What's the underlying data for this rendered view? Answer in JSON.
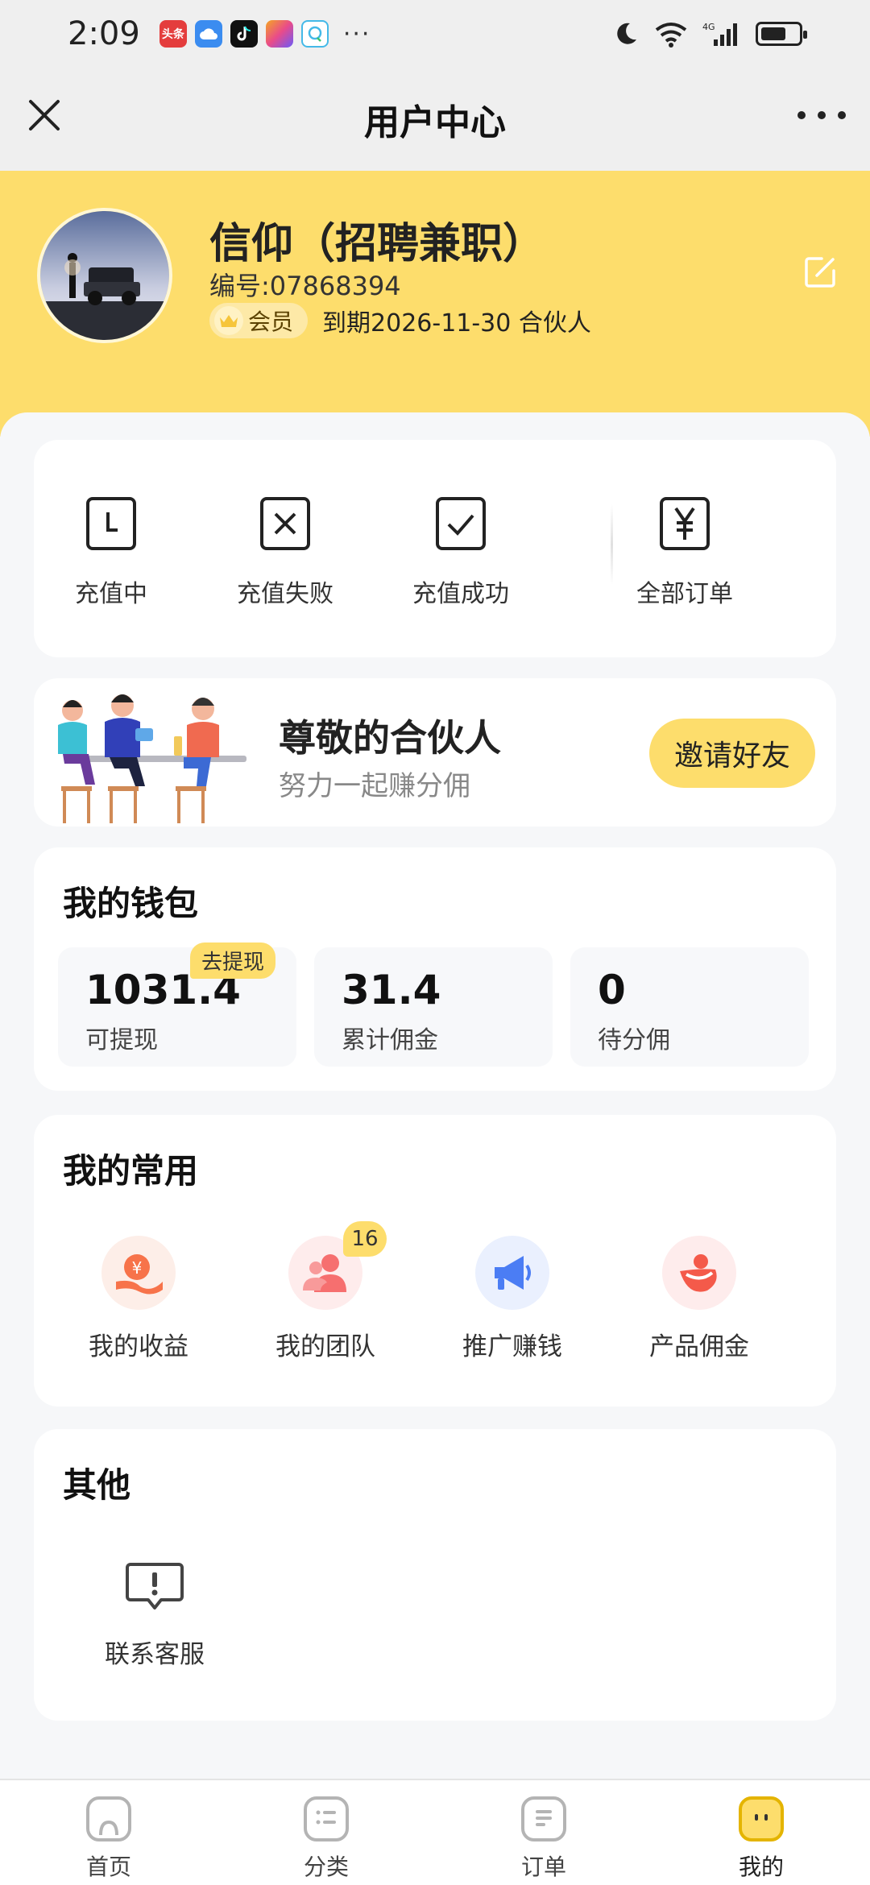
{
  "status_bar": {
    "time": "2:09",
    "app_icons": [
      {
        "name": "toutiao-icon",
        "text": "头条",
        "color": "#e43d3d"
      },
      {
        "name": "cloud-icon",
        "text": "",
        "color": "#3b8cf0"
      },
      {
        "name": "tiktok-icon",
        "text": "",
        "color": "#111111"
      },
      {
        "name": "app-icon",
        "text": "",
        "color": "#f5a623"
      },
      {
        "name": "chat-icon",
        "text": "",
        "color": "#44b9e8"
      }
    ],
    "more": "···",
    "network": "4G"
  },
  "header": {
    "title": "用户中心"
  },
  "profile": {
    "name": "信仰（招聘兼职）",
    "id_text": "编号:07868394",
    "member_label": "会员",
    "expiry_text": "到期2026-11-30 合伙人"
  },
  "orders": [
    {
      "label": "充值中",
      "icon": "clock-icon"
    },
    {
      "label": "充值失败",
      "icon": "failed-icon"
    },
    {
      "label": "充值成功",
      "icon": "success-icon"
    },
    {
      "label": "全部订单",
      "icon": "yuan-icon"
    }
  ],
  "banner": {
    "title": "尊敬的合伙人",
    "subtitle": "努力一起赚分佣",
    "button": "邀请好友"
  },
  "wallet": {
    "title": "我的钱包",
    "withdraw_tag": "去提现",
    "items": [
      {
        "value": "1031.4",
        "label": "可提现"
      },
      {
        "value": "31.4",
        "label": "累计佣金"
      },
      {
        "value": "0",
        "label": "待分佣"
      }
    ]
  },
  "common": {
    "title": "我的常用",
    "items": [
      {
        "label": "我的收益",
        "icon": "earnings-icon",
        "color": "#f7734a"
      },
      {
        "label": "我的团队",
        "icon": "team-icon",
        "color": "#f66f6f",
        "badge": "16"
      },
      {
        "label": "推广赚钱",
        "icon": "megaphone-icon",
        "color": "#4b7df4"
      },
      {
        "label": "产品佣金",
        "icon": "commission-icon",
        "color": "#f45a4a"
      }
    ]
  },
  "other": {
    "title": "其他",
    "items": [
      {
        "label": "联系客服",
        "icon": "support-icon"
      }
    ]
  },
  "nav": [
    {
      "label": "首页",
      "icon": "home-icon"
    },
    {
      "label": "分类",
      "icon": "category-icon"
    },
    {
      "label": "订单",
      "icon": "order-icon"
    },
    {
      "label": "我的",
      "icon": "mine-icon",
      "active": true
    }
  ],
  "colors": {
    "accent_yellow": "#fddd6c",
    "background": "#f6f7f9"
  }
}
